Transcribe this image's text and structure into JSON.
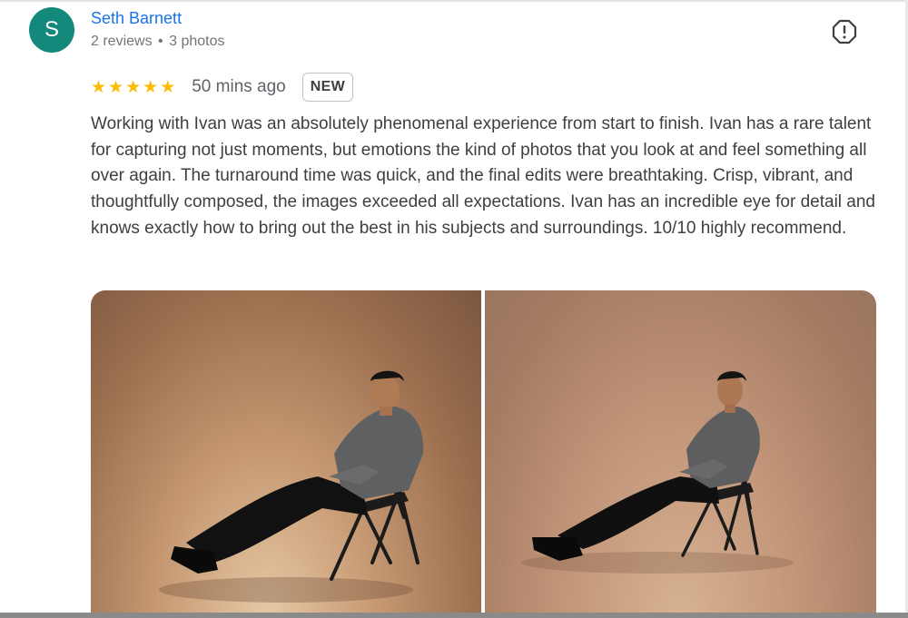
{
  "review": {
    "avatar_letter": "S",
    "avatar_color": "#13897b",
    "author": "Seth Barnett",
    "reviews_count": "2 reviews",
    "separator": "•",
    "photos_count": "3 photos",
    "rating": 5,
    "rating_max": 5,
    "star_color": "#fbbc04",
    "time": "50 mins ago",
    "badge": "NEW",
    "text": "Working with Ivan was an absolutely phenomenal experience from start to finish. Ivan has a rare talent for capturing not just moments, but emotions the kind of photos that you look at and feel something all over again. The turnaround time was quick, and the final edits were breathtaking. Crisp, vibrant, and thoughtfully composed, the images exceeded all expectations. Ivan has an incredible eye for detail and knows exactly how to bring out the best in his subjects and surroundings. 10/10 highly recommend."
  },
  "icons": {
    "report": "report-flag-icon",
    "star": "star-icon"
  },
  "colors": {
    "author_link": "#1a73e8",
    "secondary_text": "#70757a"
  }
}
